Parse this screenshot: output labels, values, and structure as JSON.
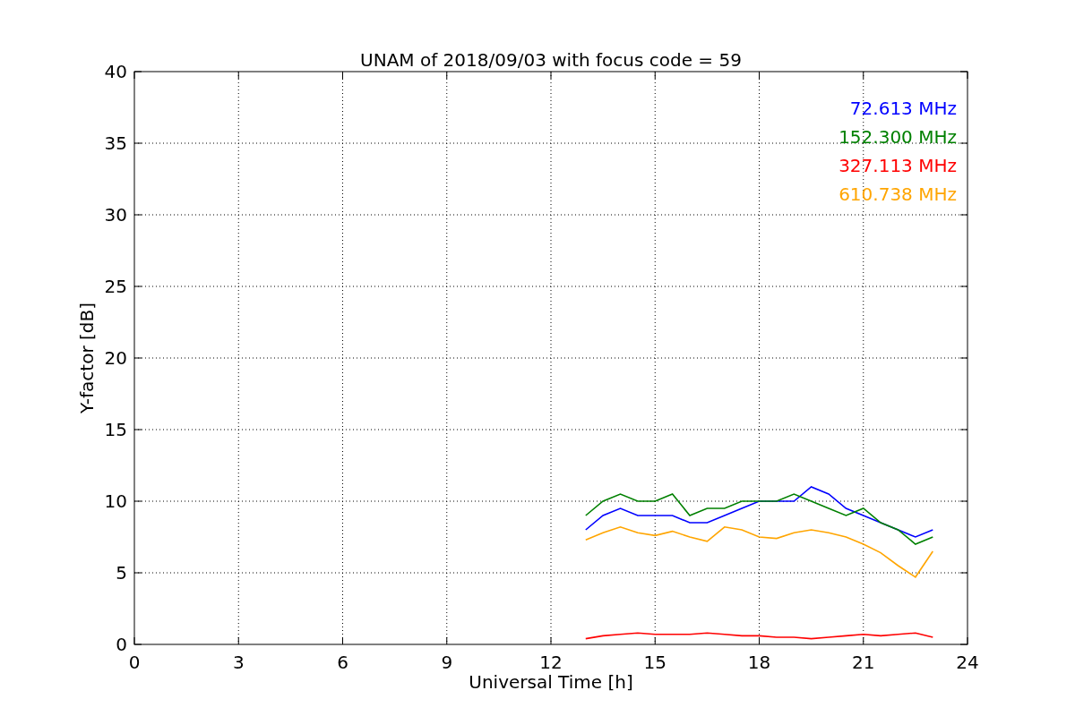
{
  "chart_data": {
    "type": "line",
    "title": "UNAM of 2018/09/03 with focus code = 59",
    "xlabel": "Universal Time [h]",
    "ylabel": "Y-factor [dB]",
    "x": [
      13,
      13.5,
      14,
      14.5,
      15,
      15.5,
      16,
      16.5,
      17,
      17.5,
      18,
      18.5,
      19,
      19.5,
      20,
      20.5,
      21,
      21.5,
      22,
      22.5,
      23
    ],
    "series": [
      {
        "name": "72.613 MHz",
        "color": "#0000ff",
        "values": [
          8,
          9,
          9.5,
          9,
          9,
          9,
          8.5,
          8.5,
          9,
          9.5,
          10,
          10,
          10,
          11,
          10.5,
          9.5,
          9,
          8.5,
          8,
          7.5,
          8
        ]
      },
      {
        "name": "152.300 MHz",
        "color": "#008000",
        "values": [
          9,
          10,
          10.5,
          10,
          10,
          10.5,
          9,
          9.5,
          9.5,
          10,
          10,
          10,
          10.5,
          10,
          9.5,
          9,
          9.5,
          8.5,
          8,
          7,
          7.5
        ]
      },
      {
        "name": "327.113 MHz",
        "color": "#ff0000",
        "values": [
          0.4,
          0.6,
          0.7,
          0.8,
          0.7,
          0.7,
          0.7,
          0.8,
          0.7,
          0.6,
          0.6,
          0.5,
          0.5,
          0.4,
          0.5,
          0.6,
          0.7,
          0.6,
          0.7,
          0.8,
          0.5
        ]
      },
      {
        "name": "610.738 MHz",
        "color": "#ffa500",
        "values": [
          7.3,
          7.8,
          8.2,
          7.8,
          7.6,
          7.9,
          7.5,
          7.2,
          8.2,
          8,
          7.5,
          7.4,
          7.8,
          8,
          7.8,
          7.5,
          7,
          6.4,
          5.5,
          4.7,
          6.5
        ]
      }
    ],
    "grid": true,
    "xlim": [
      0,
      24
    ],
    "ylim": [
      0,
      40
    ],
    "xticks": [
      0,
      3,
      6,
      9,
      12,
      15,
      18,
      21,
      24
    ],
    "yticks": [
      0,
      5,
      10,
      15,
      20,
      25,
      30,
      35,
      40
    ]
  }
}
